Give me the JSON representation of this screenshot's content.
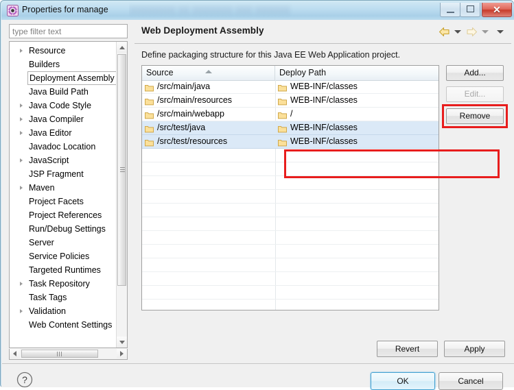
{
  "window": {
    "title": "Properties for manage",
    "icon": "properties-gear-icon",
    "obscured_text": "░░░░░░░░ ░░ ░░░░░░░ ░░░ ░░░░░░",
    "minimize_label": "─",
    "maximize_label": "□",
    "close_label": "✕"
  },
  "filter": {
    "placeholder": "type filter text",
    "value": ""
  },
  "tree": {
    "items": [
      {
        "label": "Resource",
        "expandable": true,
        "selected": false
      },
      {
        "label": "Builders",
        "expandable": false,
        "selected": false
      },
      {
        "label": "Deployment Assembly",
        "expandable": false,
        "selected": true
      },
      {
        "label": "Java Build Path",
        "expandable": false,
        "selected": false
      },
      {
        "label": "Java Code Style",
        "expandable": true,
        "selected": false
      },
      {
        "label": "Java Compiler",
        "expandable": true,
        "selected": false
      },
      {
        "label": "Java Editor",
        "expandable": true,
        "selected": false
      },
      {
        "label": "Javadoc Location",
        "expandable": false,
        "selected": false
      },
      {
        "label": "JavaScript",
        "expandable": true,
        "selected": false
      },
      {
        "label": "JSP Fragment",
        "expandable": false,
        "selected": false
      },
      {
        "label": "Maven",
        "expandable": true,
        "selected": false
      },
      {
        "label": "Project Facets",
        "expandable": false,
        "selected": false
      },
      {
        "label": "Project References",
        "expandable": false,
        "selected": false
      },
      {
        "label": "Run/Debug Settings",
        "expandable": false,
        "selected": false
      },
      {
        "label": "Server",
        "expandable": false,
        "selected": false
      },
      {
        "label": "Service Policies",
        "expandable": false,
        "selected": false
      },
      {
        "label": "Targeted Runtimes",
        "expandable": false,
        "selected": false
      },
      {
        "label": "Task Repository",
        "expandable": true,
        "selected": false
      },
      {
        "label": "Task Tags",
        "expandable": false,
        "selected": false
      },
      {
        "label": "Validation",
        "expandable": true,
        "selected": false
      },
      {
        "label": "Web Content Settings",
        "expandable": false,
        "selected": false
      }
    ]
  },
  "page": {
    "title": "Web Deployment Assembly",
    "description": "Define packaging structure for this Java EE Web Application project.",
    "nav": {
      "back_icon": "back-arrow-icon",
      "back_menu_icon": "chevron-down-icon",
      "forward_icon": "forward-arrow-icon",
      "forward_menu_icon": "chevron-down-icon",
      "overflow_menu_icon": "chevron-down-icon"
    }
  },
  "table": {
    "columns": [
      "Source",
      "Deploy Path"
    ],
    "sort_column": "Source",
    "sort_direction": "ascending",
    "rows": [
      {
        "source": "/src/main/java",
        "deploy": "WEB-INF/classes",
        "selected": false
      },
      {
        "source": "/src/main/resources",
        "deploy": "WEB-INF/classes",
        "selected": false
      },
      {
        "source": "/src/main/webapp",
        "deploy": "/",
        "selected": false
      },
      {
        "source": "/src/test/java",
        "deploy": "WEB-INF/classes",
        "selected": true
      },
      {
        "source": "/src/test/resources",
        "deploy": "WEB-INF/classes",
        "selected": true
      }
    ],
    "empty_row_count": 12
  },
  "side_buttons": {
    "add": {
      "label": "Add...",
      "mnemonic": "d",
      "enabled": true
    },
    "edit": {
      "label": "Edit...",
      "mnemonic": "E",
      "enabled": false
    },
    "remove": {
      "label": "Remove",
      "mnemonic": "R",
      "enabled": true,
      "highlighted": true
    }
  },
  "bottom_buttons": {
    "revert": {
      "label": "Revert",
      "mnemonic": "v"
    },
    "apply": {
      "label": "Apply",
      "mnemonic": "A"
    },
    "ok": {
      "label": "OK",
      "default": true
    },
    "cancel": {
      "label": "Cancel"
    }
  },
  "help": {
    "icon": "help-question-icon",
    "label": "?"
  },
  "colors": {
    "annotation_red": "#e81d1d",
    "selection_blue": "#dbe9f7",
    "titlebar_blue": "#bdddf0",
    "close_red": "#c83c2c",
    "default_button_border": "#3f9fd0",
    "folder_icon": "#f5d88f"
  }
}
